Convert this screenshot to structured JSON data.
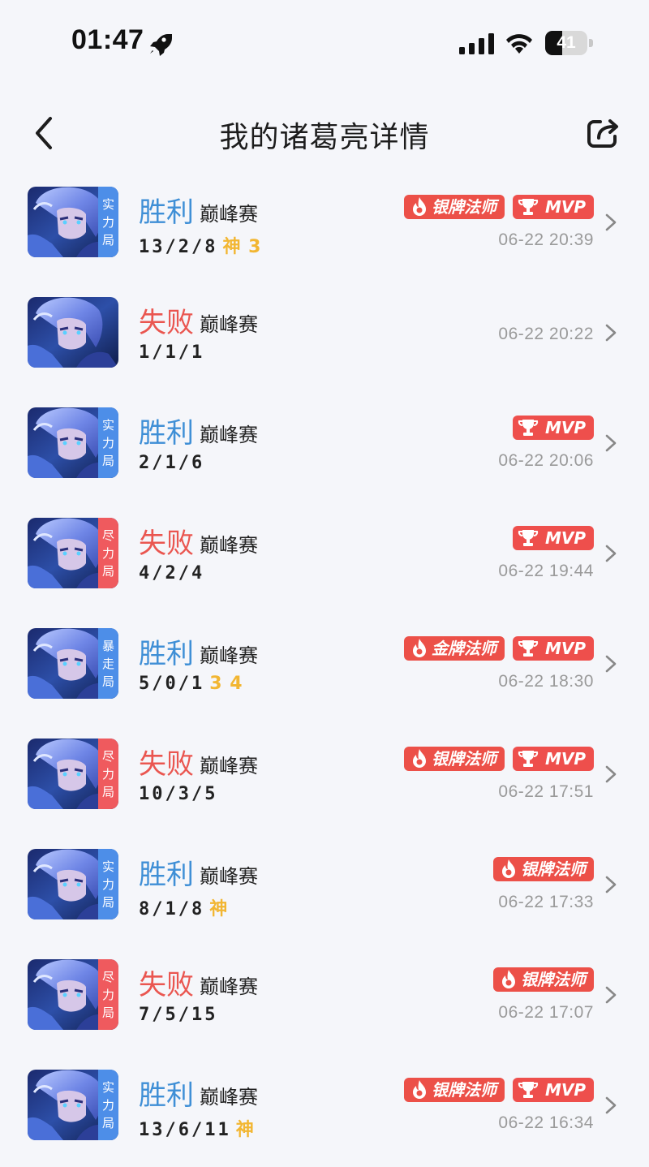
{
  "status_bar": {
    "time": "01:47",
    "battery": "41",
    "battery_level": 0.41
  },
  "nav": {
    "title": "我的诸葛亮详情"
  },
  "matches": [
    {
      "result": "胜利",
      "outcome": "win",
      "type": "巅峰赛",
      "kda": "13/2/8",
      "extra": "神 3",
      "mode": [
        "实",
        "力",
        "局"
      ],
      "mode_color": "blue",
      "badges": [
        "银牌法师",
        "MVP"
      ],
      "time": "06-22 20:39"
    },
    {
      "result": "失败",
      "outcome": "loss",
      "type": "巅峰赛",
      "kda": "1/1/1",
      "extra": "",
      "mode": [],
      "mode_color": "none",
      "badges": [],
      "time": "06-22 20:22"
    },
    {
      "result": "胜利",
      "outcome": "win",
      "type": "巅峰赛",
      "kda": "2/1/6",
      "extra": "",
      "mode": [
        "实",
        "力",
        "局"
      ],
      "mode_color": "blue",
      "badges": [
        "MVP"
      ],
      "time": "06-22 20:06"
    },
    {
      "result": "失败",
      "outcome": "loss",
      "type": "巅峰赛",
      "kda": "4/2/4",
      "extra": "",
      "mode": [
        "尽",
        "力",
        "局"
      ],
      "mode_color": "red",
      "badges": [
        "MVP"
      ],
      "time": "06-22 19:44"
    },
    {
      "result": "胜利",
      "outcome": "win",
      "type": "巅峰赛",
      "kda": "5/0/1",
      "extra": "3 4",
      "mode": [
        "暴",
        "走",
        "局"
      ],
      "mode_color": "blue",
      "badges": [
        "金牌法师",
        "MVP"
      ],
      "time": "06-22 18:30"
    },
    {
      "result": "失败",
      "outcome": "loss",
      "type": "巅峰赛",
      "kda": "10/3/5",
      "extra": "",
      "mode": [
        "尽",
        "力",
        "局"
      ],
      "mode_color": "red",
      "badges": [
        "银牌法师",
        "MVP"
      ],
      "time": "06-22 17:51"
    },
    {
      "result": "胜利",
      "outcome": "win",
      "type": "巅峰赛",
      "kda": "8/1/8",
      "extra": "神",
      "mode": [
        "实",
        "力",
        "局"
      ],
      "mode_color": "blue",
      "badges": [
        "银牌法师"
      ],
      "time": "06-22 17:33"
    },
    {
      "result": "失败",
      "outcome": "loss",
      "type": "巅峰赛",
      "kda": "7/5/15",
      "extra": "",
      "mode": [
        "尽",
        "力",
        "局"
      ],
      "mode_color": "red",
      "badges": [
        "银牌法师"
      ],
      "time": "06-22 17:07"
    },
    {
      "result": "胜利",
      "outcome": "win",
      "type": "巅峰赛",
      "kda": "13/6/11",
      "extra": "神",
      "mode": [
        "实",
        "力",
        "局"
      ],
      "mode_color": "blue",
      "badges": [
        "银牌法师",
        "MVP"
      ],
      "time": "06-22 16:34"
    }
  ]
}
